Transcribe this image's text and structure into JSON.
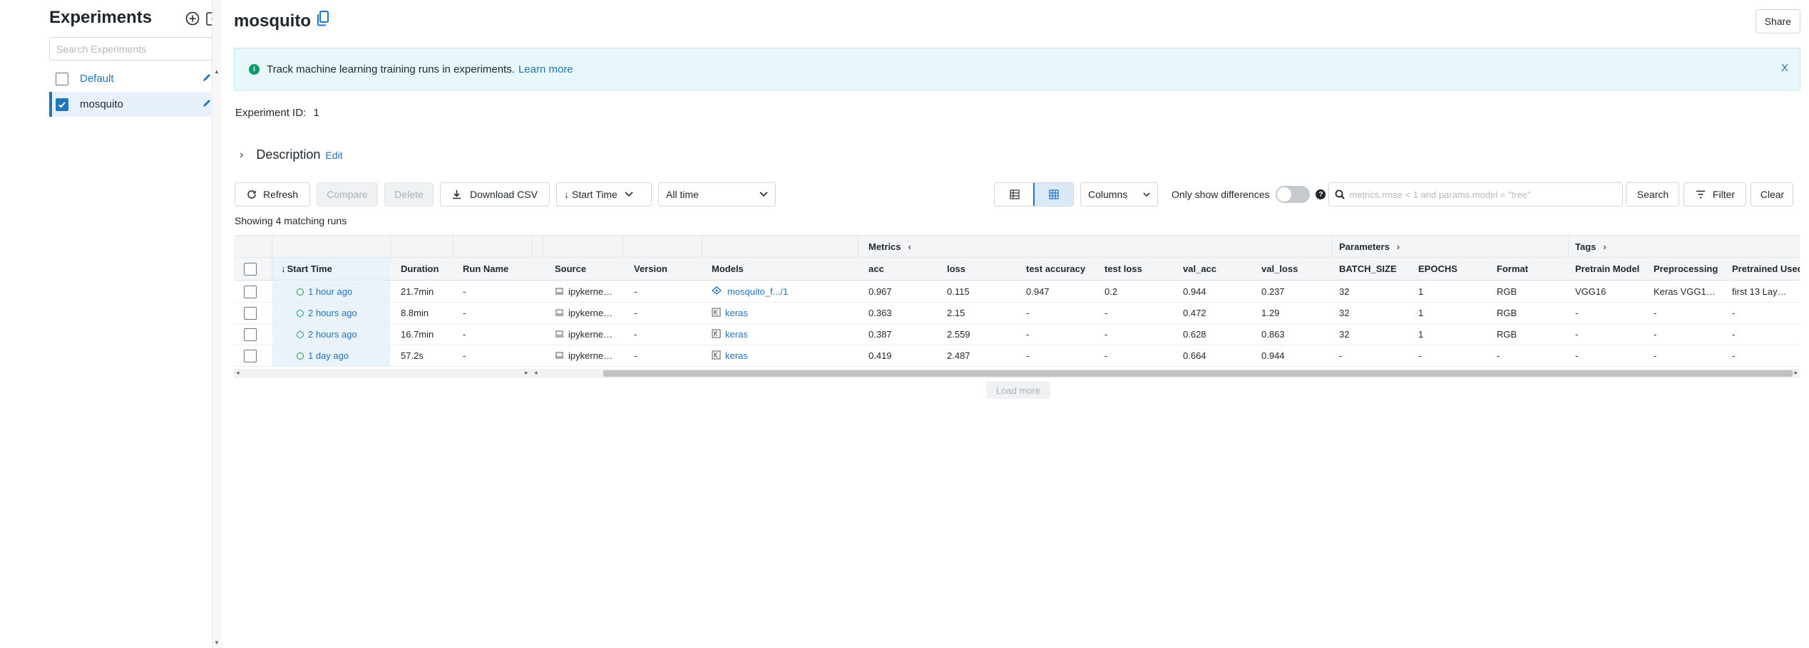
{
  "sidebar": {
    "title": "Experiments",
    "search_placeholder": "Search Experiments",
    "items": [
      {
        "label": "Default",
        "checked": false
      },
      {
        "label": "mosquito",
        "checked": true
      }
    ]
  },
  "header": {
    "title": "mosquito",
    "share_label": "Share"
  },
  "banner": {
    "text": "Track machine learning training runs in experiments.",
    "link": "Learn more",
    "close": "X"
  },
  "experiment": {
    "id_label": "Experiment ID:",
    "id_value": "1",
    "description_label": "Description",
    "edit_label": "Edit"
  },
  "toolbar": {
    "refresh": "Refresh",
    "compare": "Compare",
    "delete": "Delete",
    "download": "Download CSV",
    "sort": "Start Time",
    "time_range": "All time",
    "columns": "Columns",
    "only_diff": "Only show differences",
    "search_placeholder": "metrics.rmse < 1 and params.model = \"tree\"",
    "search": "Search",
    "filter": "Filter",
    "clear": "Clear"
  },
  "showing_text": "Showing 4 matching runs",
  "table": {
    "groups": {
      "metrics": "Metrics",
      "parameters": "Parameters",
      "tags": "Tags"
    },
    "headers": [
      "Start Time",
      "Duration",
      "Run Name",
      "Source",
      "Version",
      "Models",
      "acc",
      "loss",
      "test accuracy",
      "test loss",
      "val_acc",
      "val_loss",
      "BATCH_SIZE",
      "EPOCHS",
      "Format",
      "Pretrain Model",
      "Preprocessing",
      "Pretrained Used"
    ],
    "rows": [
      [
        "1 hour ago",
        "21.7min",
        "-",
        "ipykerne…",
        "-",
        "mosquito_f.../1",
        "0.967",
        "0.115",
        "0.947",
        "0.2",
        "0.944",
        "0.237",
        "32",
        "1",
        "RGB",
        "VGG16",
        "Keras VGG1…",
        "first 13 Lay…"
      ],
      [
        "2 hours ago",
        "8.8min",
        "-",
        "ipykerne…",
        "-",
        "keras",
        "0.363",
        "2.15",
        "-",
        "-",
        "0.472",
        "1.29",
        "32",
        "1",
        "RGB",
        "-",
        "-",
        "-"
      ],
      [
        "2 hours ago",
        "16.7min",
        "-",
        "ipykerne…",
        "-",
        "keras",
        "0.387",
        "2.559",
        "-",
        "-",
        "0.628",
        "0.863",
        "32",
        "1",
        "RGB",
        "-",
        "-",
        "-"
      ],
      [
        "1 day ago",
        "57.2s",
        "-",
        "ipykerne…",
        "-",
        "keras",
        "0.419",
        "2.487",
        "-",
        "-",
        "0.664",
        "0.944",
        "-",
        "-",
        "-",
        "-",
        "-",
        "-"
      ]
    ]
  },
  "load_more": "Load more"
}
